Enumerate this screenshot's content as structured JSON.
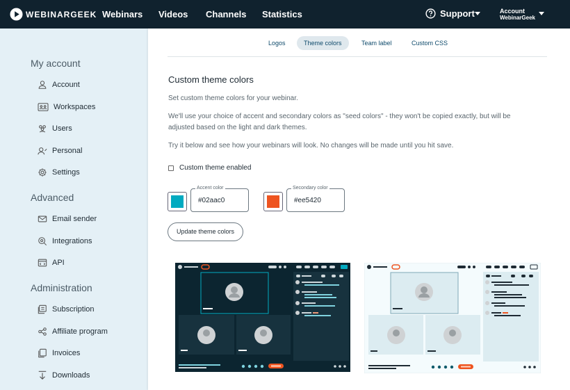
{
  "app": {
    "brand": "WEBINARGEEK"
  },
  "nav": {
    "items": [
      "Webinars",
      "Videos",
      "Channels",
      "Statistics"
    ],
    "support": "Support",
    "account_label": "Account",
    "account_name": "WebinarGeek"
  },
  "sidebar": {
    "sections": [
      {
        "title": "My account",
        "items": [
          {
            "label": "Account",
            "icon": "user-icon"
          },
          {
            "label": "Workspaces",
            "icon": "workspaces-icon"
          },
          {
            "label": "Users",
            "icon": "users-icon"
          },
          {
            "label": "Personal",
            "icon": "personal-icon"
          },
          {
            "label": "Settings",
            "icon": "gear-icon"
          }
        ]
      },
      {
        "title": "Advanced",
        "items": [
          {
            "label": "Email sender",
            "icon": "envelope-icon"
          },
          {
            "label": "Integrations",
            "icon": "integrations-icon"
          },
          {
            "label": "API",
            "icon": "api-icon"
          }
        ]
      },
      {
        "title": "Administration",
        "items": [
          {
            "label": "Subscription",
            "icon": "subscription-icon"
          },
          {
            "label": "Affiliate program",
            "icon": "affiliate-icon"
          },
          {
            "label": "Invoices",
            "icon": "invoices-icon"
          },
          {
            "label": "Downloads",
            "icon": "download-icon"
          }
        ]
      }
    ]
  },
  "tabs": [
    {
      "label": "Logos",
      "active": false
    },
    {
      "label": "Theme colors",
      "active": true
    },
    {
      "label": "Team label",
      "active": false
    },
    {
      "label": "Custom CSS",
      "active": false
    }
  ],
  "content": {
    "title": "Custom theme colors",
    "p1": "Set custom theme colors for your webinar.",
    "p2": "We'll use your choice of accent and secondary colors as \"seed colors\" - they won't be copied exactly, but will be adjusted based on the light and dark themes.",
    "p3": "Try it below and see how your webinars will look. No changes will be made until you hit save.",
    "checkbox_label": "Custom theme enabled",
    "checkbox_checked": false,
    "accent": {
      "label": "Accent color",
      "value": "#02aac0"
    },
    "secondary": {
      "label": "Secondary color",
      "value": "#ee5420"
    },
    "button": "Update theme colors"
  },
  "colors": {
    "topbar": "#10222e",
    "sidebar_bg": "#e4f0f6",
    "accent": "#02aac0",
    "secondary": "#ee5420"
  },
  "previews": [
    {
      "theme": "dark"
    },
    {
      "theme": "light"
    }
  ]
}
